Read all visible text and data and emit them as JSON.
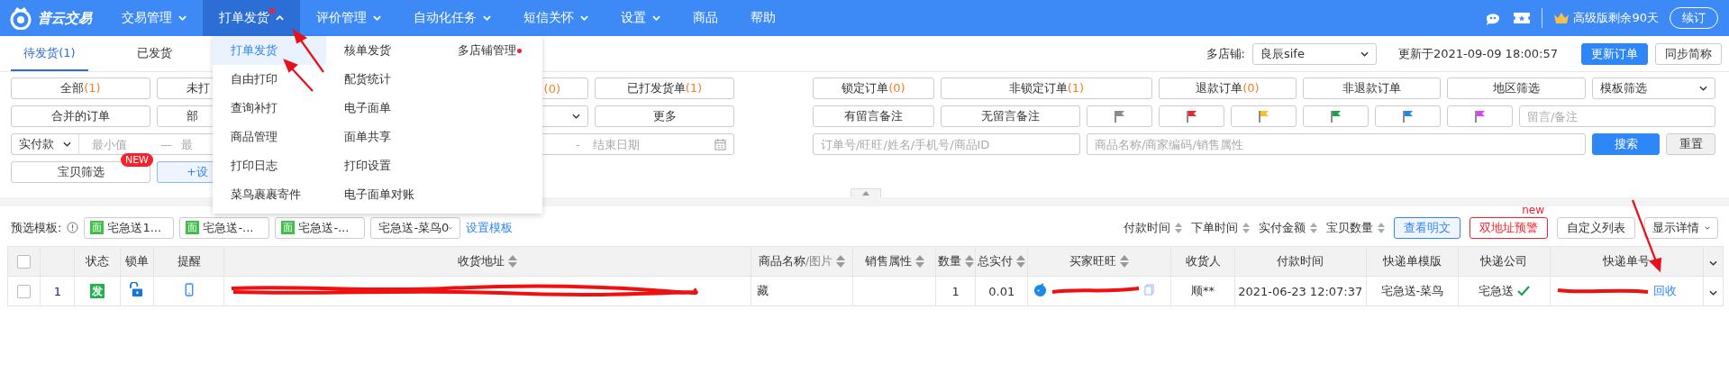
{
  "logo": {
    "text": "普云交易"
  },
  "nav_items": [
    {
      "label": "交易管理",
      "has_menu": true,
      "expanded": false,
      "dot": false
    },
    {
      "label": "打单发货",
      "has_menu": true,
      "expanded": true,
      "dot": true
    },
    {
      "label": "评价管理",
      "has_menu": true,
      "expanded": false,
      "dot": false
    },
    {
      "label": "自动化任务",
      "has_menu": true,
      "expanded": false,
      "dot": false
    },
    {
      "label": "短信关怀",
      "has_menu": true,
      "expanded": false,
      "dot": false
    },
    {
      "label": "设置",
      "has_menu": true,
      "expanded": false,
      "dot": false
    },
    {
      "label": "商品",
      "has_menu": false,
      "expanded": false,
      "dot": false
    },
    {
      "label": "帮助",
      "has_menu": false,
      "expanded": false,
      "dot": false
    }
  ],
  "account": {
    "plan": "高级版剩余90天",
    "renew": "续订"
  },
  "tabs": [
    {
      "label": "待发货(1)",
      "selected": true
    },
    {
      "label": "已发货",
      "selected": false
    }
  ],
  "shop": {
    "label": "多店铺:",
    "value": "良辰sife"
  },
  "updated": "更新于2021-09-09 18:00:57",
  "header_buttons": [
    {
      "label": "更新订单",
      "kind": "primary"
    },
    {
      "label": "同步简称",
      "kind": "default"
    }
  ],
  "dropdown_menu": {
    "columns": [
      [
        {
          "label": "打单发货",
          "selected": true,
          "dot": false
        },
        {
          "label": "自由打印",
          "selected": false,
          "dot": false
        },
        {
          "label": "查询补打",
          "selected": false,
          "dot": false
        },
        {
          "label": "商品管理",
          "selected": false,
          "dot": false
        },
        {
          "label": "打印日志",
          "selected": false,
          "dot": false
        },
        {
          "label": "菜鸟裹裹寄件",
          "selected": false,
          "dot": false
        }
      ],
      [
        {
          "label": "核单发货",
          "selected": false,
          "dot": false
        },
        {
          "label": "配货统计",
          "selected": false,
          "dot": false
        },
        {
          "label": "电子面单",
          "selected": false,
          "dot": false
        },
        {
          "label": "面单共享",
          "selected": false,
          "dot": false
        },
        {
          "label": "打印设置",
          "selected": false,
          "dot": false
        },
        {
          "label": "电子面单对账",
          "selected": false,
          "dot": false
        }
      ],
      [
        {
          "label": "多店铺管理",
          "selected": false,
          "dot": true
        }
      ]
    ]
  },
  "filters_left": {
    "row1": [
      {
        "label": "全部",
        "count": "(1)"
      },
      {
        "label": "未打"
      },
      {
        "count": "(0)"
      },
      {
        "label": "已打发货单",
        "count": "(1)"
      }
    ],
    "row2": [
      {
        "label": "合并的订单"
      },
      {
        "label": "部"
      },
      {
        "label": "更多"
      }
    ],
    "amount": {
      "select": "实付款",
      "min_placeholder": "最小值",
      "separator": "—",
      "max_placeholder": "最"
    },
    "date": {
      "separator": "-",
      "end_placeholder": "结束日期"
    },
    "product_filter": {
      "label": "宝贝筛选",
      "badge": "NEW"
    },
    "settings_link": "+设"
  },
  "filters_right": {
    "row1": [
      {
        "label": "锁定订单",
        "count": "(0)"
      },
      {
        "label": "非锁定订单",
        "count": "(1)"
      },
      {
        "label": "退款订单",
        "count": "(0)"
      },
      {
        "label": "非退款订单"
      },
      {
        "label": "地区筛选"
      }
    ],
    "template_select": "模板筛选",
    "remarks": [
      {
        "label": "有留言备注"
      },
      {
        "label": "无留言备注"
      }
    ],
    "flags": [
      {
        "color": "#8c8c8c"
      },
      {
        "color": "#f5222d"
      },
      {
        "color": "#fbbf24"
      },
      {
        "color": "#16a34a"
      },
      {
        "color": "#1e88e5"
      },
      {
        "color": "#e040fb"
      }
    ],
    "remark_placeholder": "留言/备注",
    "order_placeholder": "订单号/旺旺/姓名/手机号/商品ID",
    "product_placeholder": "商品名称/商家编码/销售属性",
    "search": "搜索",
    "reset": "重置"
  },
  "toolbar": {
    "label": "预选模板:",
    "templates": [
      {
        "badge": "面",
        "label": "宅急送1..."
      },
      {
        "badge": "面",
        "label": "宅急送-..."
      },
      {
        "badge": "面",
        "label": "宅急送-..."
      }
    ],
    "template_select": "宅急送-菜鸟0",
    "settings_link": "设置模板",
    "sorts": [
      "付款时间",
      "下单时间",
      "实付金额",
      "宝贝数量"
    ],
    "buttons": [
      {
        "label": "查看明文",
        "kind": "primary-outline"
      },
      {
        "label": "双地址预警",
        "kind": "danger-outline",
        "tag": "new"
      },
      {
        "label": "自定义列表",
        "kind": "default"
      }
    ],
    "detail_select": "显示详情"
  },
  "table": {
    "select_all": {
      "checked": false
    },
    "columns": [
      {
        "label": "状态",
        "sortable": false
      },
      {
        "label": "锁单",
        "sortable": false
      },
      {
        "label": "提醒",
        "sortable": false
      },
      {
        "label": "收货地址",
        "sortable": true
      },
      {
        "label": "商品名称",
        "sub": "/图片",
        "sortable": true
      },
      {
        "label": "销售属性",
        "sortable": true
      },
      {
        "label": "数量",
        "sortable": true
      },
      {
        "label": "总实付",
        "sortable": true
      },
      {
        "label": "买家旺旺",
        "sortable": true
      },
      {
        "label": "收货人",
        "sortable": false
      },
      {
        "label": "付款时间",
        "sortable": false
      },
      {
        "label": "快递单模版",
        "sortable": false
      },
      {
        "label": "快递公司",
        "sortable": false
      },
      {
        "label": "快递单号",
        "sortable": false
      }
    ],
    "rows": [
      {
        "selected": false,
        "index": "1",
        "status": "发",
        "locked": false,
        "product": "藏",
        "quantity": "1",
        "total": "0.01",
        "receiver": "顺**",
        "paid_time": "2021-06-23 12:07:37",
        "template": "宅急送-菜鸟",
        "courier": "宅急送",
        "courier_ok": true,
        "action": "回收"
      }
    ]
  }
}
